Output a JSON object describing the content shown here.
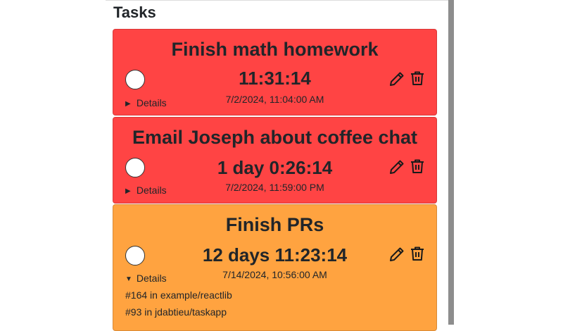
{
  "panel": {
    "title": "Tasks"
  },
  "colors": {
    "overdue": "#ff4444",
    "upcoming": "#ffa340"
  },
  "tasks": [
    {
      "title": "Finish math homework",
      "countdown": "11:31:14",
      "due": "7/2/2024, 11:04:00 AM",
      "details_label": "Details",
      "details_open": false,
      "details_marker": "▶",
      "details_lines": []
    },
    {
      "title": "Email Joseph about coffee chat",
      "countdown": "1 day 0:26:14",
      "due": "7/2/2024, 11:59:00 PM",
      "details_label": "Details",
      "details_open": false,
      "details_marker": "▶",
      "details_lines": []
    },
    {
      "title": "Finish PRs",
      "countdown": "12 days 11:23:14",
      "due": "7/14/2024, 10:56:00 AM",
      "details_label": "Details",
      "details_open": true,
      "details_marker": "▼",
      "details_lines": [
        "#164 in example/reactlib",
        "#93 in jdabtieu/taskapp"
      ]
    }
  ],
  "icons": {
    "edit": "pencil-icon",
    "delete": "trash-icon"
  }
}
